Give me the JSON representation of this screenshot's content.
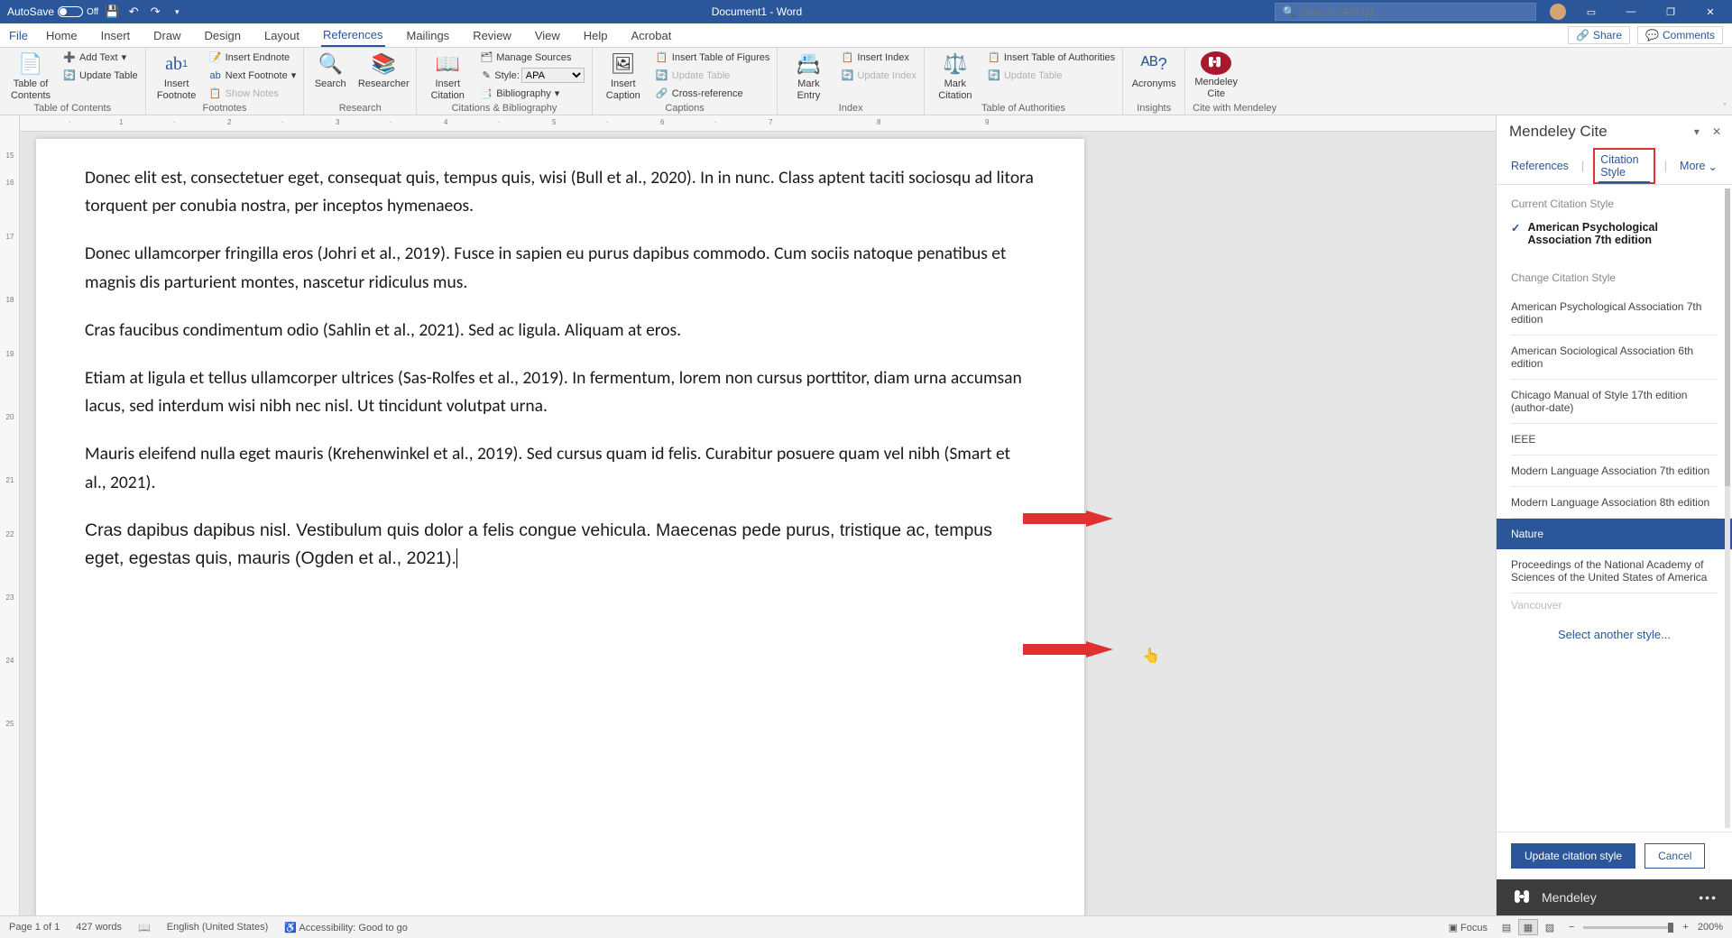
{
  "titlebar": {
    "autosave_label": "AutoSave",
    "autosave_state": "Off",
    "doc_title": "Document1 - Word",
    "search_placeholder": "Search (Alt+Q)"
  },
  "tabs": {
    "file": "File",
    "list": [
      "Home",
      "Insert",
      "Draw",
      "Design",
      "Layout",
      "References",
      "Mailings",
      "Review",
      "View",
      "Help",
      "Acrobat"
    ],
    "active": "References",
    "share": "Share",
    "comments": "Comments"
  },
  "ribbon": {
    "toc": {
      "big": "Table of Contents",
      "items": [
        "Add Text",
        "Update Table"
      ],
      "label": "Table of Contents"
    },
    "footnotes": {
      "big": "Insert Footnote",
      "items": [
        "Insert Endnote",
        "Next Footnote",
        "Show Notes"
      ],
      "label": "Footnotes"
    },
    "research": {
      "search": "Search",
      "researcher": "Researcher",
      "label": "Research"
    },
    "citations": {
      "big": "Insert Citation",
      "manage": "Manage Sources",
      "style_label": "Style:",
      "style_value": "APA",
      "biblio": "Bibliography",
      "label": "Citations & Bibliography"
    },
    "captions": {
      "big": "Insert Caption",
      "items": [
        "Insert Table of Figures",
        "Update Table",
        "Cross-reference"
      ],
      "label": "Captions"
    },
    "index": {
      "big": "Mark Entry",
      "items": [
        "Insert Index",
        "Update Index"
      ],
      "label": "Index"
    },
    "toa": {
      "big": "Mark Citation",
      "items": [
        "Insert Table of Authorities",
        "Update Table"
      ],
      "label": "Table of Authorities"
    },
    "insights": {
      "big": "Acronyms",
      "label": "Insights"
    },
    "mendeley": {
      "big": "Mendeley Cite",
      "label": "Cite with Mendeley"
    }
  },
  "document": {
    "paragraphs": [
      "Donec elit est, consectetuer eget, consequat quis, tempus quis, wisi (Bull et al., 2020). In in nunc. Class aptent taciti sociosqu ad litora torquent per conubia nostra, per inceptos hymenaeos.",
      "Donec ullamcorper fringilla eros (Johri et al., 2019). Fusce in sapien eu purus dapibus commodo. Cum sociis natoque penatibus et magnis dis parturient montes, nascetur ridiculus mus.",
      "Cras faucibus condimentum odio (Sahlin et al., 2021). Sed ac ligula. Aliquam at eros.",
      "Etiam at ligula et tellus ullamcorper ultrices (Sas-Rolfes et al., 2019). In fermentum, lorem non cursus porttitor, diam urna accumsan lacus, sed interdum wisi nibh nec nisl. Ut tincidunt volutpat urna.",
      "Mauris eleifend nulla eget mauris (Krehenwinkel et al., 2019). Sed cursus quam id felis. Curabitur posuere quam vel nibh (Smart et al., 2021).",
      "Cras dapibus dapibus nisl. Vestibulum quis dolor a felis congue vehicula. Maecenas pede purus, tristique ac, tempus eget, egestas quis, mauris (Ogden et al., 2021)."
    ]
  },
  "mendeley": {
    "title": "Mendeley Cite",
    "tabs": {
      "references": "References",
      "citation_style": "Citation Style",
      "more": "More"
    },
    "current_label": "Current Citation Style",
    "current_style": "American Psychological Association 7th edition",
    "change_label": "Change Citation Style",
    "styles": [
      "American Psychological Association 7th edition",
      "American Sociological Association 6th edition",
      "Chicago Manual of Style 17th edition (author-date)",
      "IEEE",
      "Modern Language Association 7th edition",
      "Modern Language Association 8th edition",
      "Nature",
      "Proceedings of the National Academy of Sciences of the United States of America",
      "Vancouver"
    ],
    "selected_style": "Nature",
    "select_another": "Select another style...",
    "update_btn": "Update citation style",
    "cancel_btn": "Cancel",
    "brand": "Mendeley"
  },
  "statusbar": {
    "page": "Page 1 of 1",
    "words": "427 words",
    "lang": "English (United States)",
    "accessibility": "Accessibility: Good to go",
    "focus": "Focus",
    "zoom": "200%"
  }
}
